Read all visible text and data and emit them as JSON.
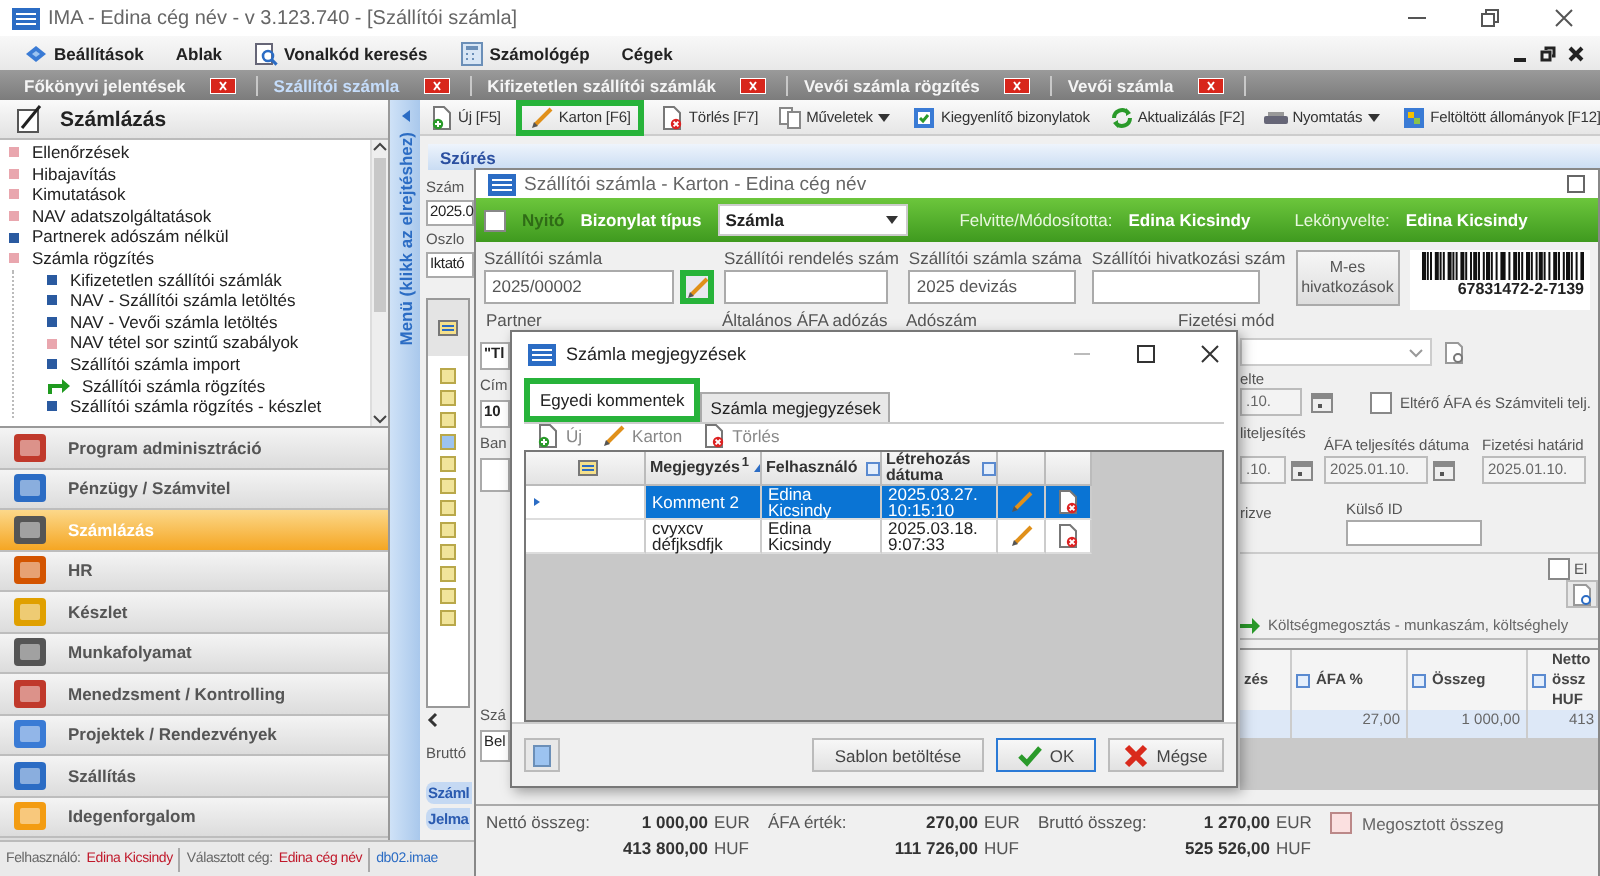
{
  "window": {
    "title": "IMA - Edina cég név - v 3.123.740 - [Szállítói számla]"
  },
  "menu": [
    {
      "label": "Beállítások",
      "kind": "settings"
    },
    {
      "label": "Ablak",
      "kind": "plain"
    },
    {
      "label": "Vonalkód keresés",
      "kind": "barcode"
    },
    {
      "label": "Számológép",
      "kind": "calculator"
    },
    {
      "label": "Cégek",
      "kind": "plain"
    }
  ],
  "document_tabs": [
    {
      "label": "Főkönyvi jelentések",
      "selected": false
    },
    {
      "label": "Szállítói számla",
      "selected": true
    },
    {
      "label": "Kifizetetlen szállítói számlák",
      "selected": false
    },
    {
      "label": "Vevői számla rögzítés",
      "selected": false
    },
    {
      "label": "Vevői számla",
      "selected": false
    }
  ],
  "sidebar": {
    "title": "Számlázás",
    "tree": [
      {
        "label": "Ellenőrzések",
        "kind": "group",
        "selected": false
      },
      {
        "label": "Hibajavítás",
        "kind": "group",
        "selected": false
      },
      {
        "label": "Kimutatások",
        "kind": "group",
        "selected": false
      },
      {
        "label": "NAV adatszolgáltatások",
        "kind": "group",
        "selected": false
      },
      {
        "label": "Partnerek adószám nélkül",
        "kind": "item",
        "selected": false
      },
      {
        "label": "Számla rögzítés",
        "kind": "group",
        "selected": false,
        "expanded": true,
        "children": [
          {
            "label": "Kifizetetlen szállítói számlák",
            "kind": "item",
            "selected": false
          },
          {
            "label": "NAV - Szállítói számla letöltés",
            "kind": "item",
            "selected": false
          },
          {
            "label": "NAV - Vevői számla letöltés",
            "kind": "item",
            "selected": false
          },
          {
            "label": "NAV tétel sor szintű szabályok",
            "kind": "group",
            "selected": false
          },
          {
            "label": "Szállítói számla import",
            "kind": "item",
            "selected": false
          },
          {
            "label": "Szállítói számla rögzítés",
            "kind": "item",
            "selected": true
          },
          {
            "label": "Szállítói számla rögzítés - készlet",
            "kind": "item",
            "selected": false
          }
        ]
      }
    ],
    "menu_toggle": "Menü (klikk az elrejtéshez)",
    "modules": [
      {
        "label": "Program adminisztráció",
        "selected": false
      },
      {
        "label": "Pénzügy / Számvitel",
        "selected": false
      },
      {
        "label": "Számlázás",
        "selected": true
      },
      {
        "label": "HR",
        "selected": false
      },
      {
        "label": "Készlet",
        "selected": false
      },
      {
        "label": "Munkafolyamat",
        "selected": false
      },
      {
        "label": "Menedzsment / Kontrolling",
        "selected": false
      },
      {
        "label": "Projektek / Rendezvények",
        "selected": false
      },
      {
        "label": "Szállítás",
        "selected": false
      },
      {
        "label": "Idegenforgalom",
        "selected": false
      }
    ]
  },
  "toolbar": [
    {
      "label": "Új [F5]",
      "kind": "new",
      "highlighted": false,
      "dropdown": false
    },
    {
      "label": "Karton [F6]",
      "kind": "edit",
      "highlighted": true,
      "dropdown": false
    },
    {
      "label": "Törlés [F7]",
      "kind": "delete",
      "highlighted": false,
      "dropdown": false
    },
    {
      "label": "Műveletek",
      "kind": "copy",
      "highlighted": false,
      "dropdown": true
    },
    {
      "label": "Kiegyenlítő bizonylatok",
      "kind": "link",
      "highlighted": false,
      "dropdown": false
    },
    {
      "label": "Aktualizálás [F2]",
      "kind": "refresh",
      "highlighted": false,
      "dropdown": false
    },
    {
      "label": "Nyomtatás",
      "kind": "print",
      "highlighted": false,
      "dropdown": true
    },
    {
      "label": "Feltöltött állományok [F12]",
      "kind": "files",
      "highlighted": false,
      "dropdown": false
    }
  ],
  "filter": {
    "title": "Szűrés",
    "invoice_label": "Szám",
    "invoice_value": "2025.0",
    "columns_label": "Oszlo",
    "columns_value": "Iktató",
    "gross_label": "Bruttó",
    "tabs": [
      {
        "label": "Száml"
      },
      {
        "label": "Jelma"
      }
    ]
  },
  "card": {
    "title": "Szállítói számla - Karton - Edina cég név",
    "opening": {
      "label": "Nyitó",
      "checked": false
    },
    "doc_type": {
      "label": "Bizonylat típus",
      "value": "Számla"
    },
    "created_by": {
      "label": "Felvitte/Módosította:",
      "value": "Edina Kicsindy"
    },
    "posted_by": {
      "label": "Lekönyvelte:",
      "value": "Edina Kicsindy"
    },
    "fields": [
      {
        "label": "Szállítói számla",
        "value": "2025/00002",
        "kind": "edit",
        "button_highlighted": true
      },
      {
        "label": "Szállítói rendelés szám",
        "kind": "plain"
      },
      {
        "label": "Szállítói számla száma",
        "value": "2025 devizás",
        "kind": "plain"
      },
      {
        "label": "Szállítói hivatkozási szám",
        "kind": "plain"
      }
    ],
    "references_button": "M-es hivatkozások",
    "barcode_text": "67831472-2-7139",
    "section_labels": [
      "Partner",
      "Általános ÁFA adózás",
      "Adószám",
      "Fizetési mód"
    ],
    "left_top": [
      {
        "kind": "field",
        "text": "\"Tl"
      },
      {
        "kind": "label",
        "text": "Cím"
      },
      {
        "kind": "field",
        "text": "10"
      },
      {
        "kind": "label",
        "text": "Ban"
      },
      {
        "kind": "field"
      }
    ],
    "left_bottom": [
      {
        "kind": "label",
        "text": "Szá"
      },
      {
        "kind": "field",
        "text": "Bel"
      }
    ],
    "issue_date": {
      "label": "elte",
      "value": ".10."
    },
    "different_vat": {
      "label": "Eltérő ÁFA és Számviteli telj.",
      "checked": false
    },
    "performance_date": {
      "label": "liteljesítés",
      "value": ".10."
    },
    "vat_date": {
      "label": "ÁFA teljesítés dátuma",
      "value": "2025.01.10."
    },
    "due_date": {
      "label": "Fizetési határid",
      "value": "2025.01.10."
    },
    "approved_label": "rizve",
    "external_id_label": "Külső ID",
    "split_checkbox": {
      "label": "El",
      "checked": false
    },
    "cost_split": "Költségmegosztás - munkaszám, költséghely",
    "lines": {
      "columns": [
        "zés",
        "ÁFA %",
        "Összeg",
        "Netto össz HUF"
      ],
      "rows": [
        {
          "vat": "27,00",
          "amount": "1 000,00",
          "net_huf": "413",
          "selected": true
        }
      ]
    },
    "totals": [
      {
        "label": "Nettó összeg:",
        "eur": "1 000,00",
        "eur_unit": "EUR",
        "huf": "413 800,00",
        "huf_unit": "HUF"
      },
      {
        "label": "ÁFA érték:",
        "eur": "270,00",
        "eur_unit": "EUR",
        "huf": "111 726,00",
        "huf_unit": "HUF"
      },
      {
        "label": "Bruttó összeg:",
        "eur": "1 270,00",
        "eur_unit": "EUR",
        "huf": "525 526,00",
        "huf_unit": "HUF"
      }
    ],
    "shared_amount": {
      "label": "Megosztott összeg",
      "checked": false
    }
  },
  "dialog": {
    "title": "Számla megjegyzések",
    "tabs": [
      {
        "label": "Egyedi kommentek",
        "selected": true,
        "highlighted": true
      },
      {
        "label": "Számla megjegyzések",
        "selected": false,
        "highlighted": false
      }
    ],
    "toolbar": [
      {
        "label": "Új",
        "kind": "new",
        "disabled": true
      },
      {
        "label": "Karton",
        "kind": "edit",
        "disabled": true
      },
      {
        "label": "Törlés",
        "kind": "delete",
        "disabled": true
      }
    ],
    "columns": [
      {
        "label": "Megjegyzés",
        "sort": "1"
      },
      {
        "label": "Felhasználó"
      },
      {
        "label": "Létrehozás dátuma"
      }
    ],
    "rows": [
      {
        "comment": "Komment 2",
        "user": "Edina Kicsindy",
        "created": "2025.03.27. 10:15:10",
        "selected": true
      },
      {
        "comment": "cvyxcv défjksdfjk",
        "user": "Edina Kicsindy",
        "created": "2025.03.18. 9:07:33",
        "selected": false
      }
    ],
    "buttons": [
      {
        "label": "Sablon betöltése",
        "kind": "plain"
      },
      {
        "label": "OK",
        "kind": "ok"
      },
      {
        "label": "Mégse",
        "kind": "cancel"
      }
    ]
  },
  "status_bar": {
    "user_label": "Felhasználó:",
    "user": "Edina Kicsindy",
    "company_label": "Választott cég:",
    "company": "Edina cég név",
    "database": "db02.imae"
  }
}
